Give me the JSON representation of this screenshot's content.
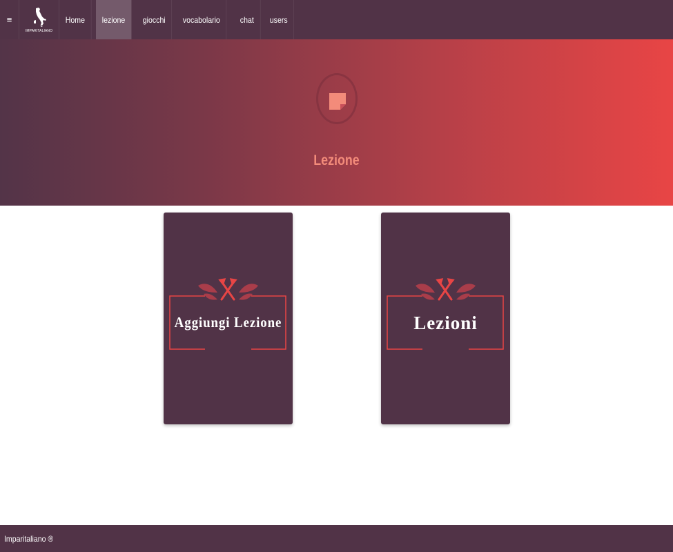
{
  "navbar": {
    "toggle_icon": "hamburger-icon",
    "brand_text": "IMPARITALIANO",
    "items": [
      {
        "label": "Home",
        "active": false
      },
      {
        "label": "lezione",
        "active": true
      },
      {
        "label": "giocchi",
        "active": false
      },
      {
        "label": "vocabolario",
        "active": false
      },
      {
        "label": "chat",
        "active": false
      },
      {
        "label": "users",
        "active": false
      }
    ]
  },
  "hero": {
    "icon": "document-icon",
    "title": "Lezione"
  },
  "cards": [
    {
      "label": "Aggiungi Lezione"
    },
    {
      "label": "Lezioni"
    }
  ],
  "footer": {
    "text": "Imparitaliano ®"
  },
  "colors": {
    "primary": "#513347",
    "accent": "#e84545",
    "hero_title": "#f38b7a",
    "active_nav": "#745a6b"
  }
}
